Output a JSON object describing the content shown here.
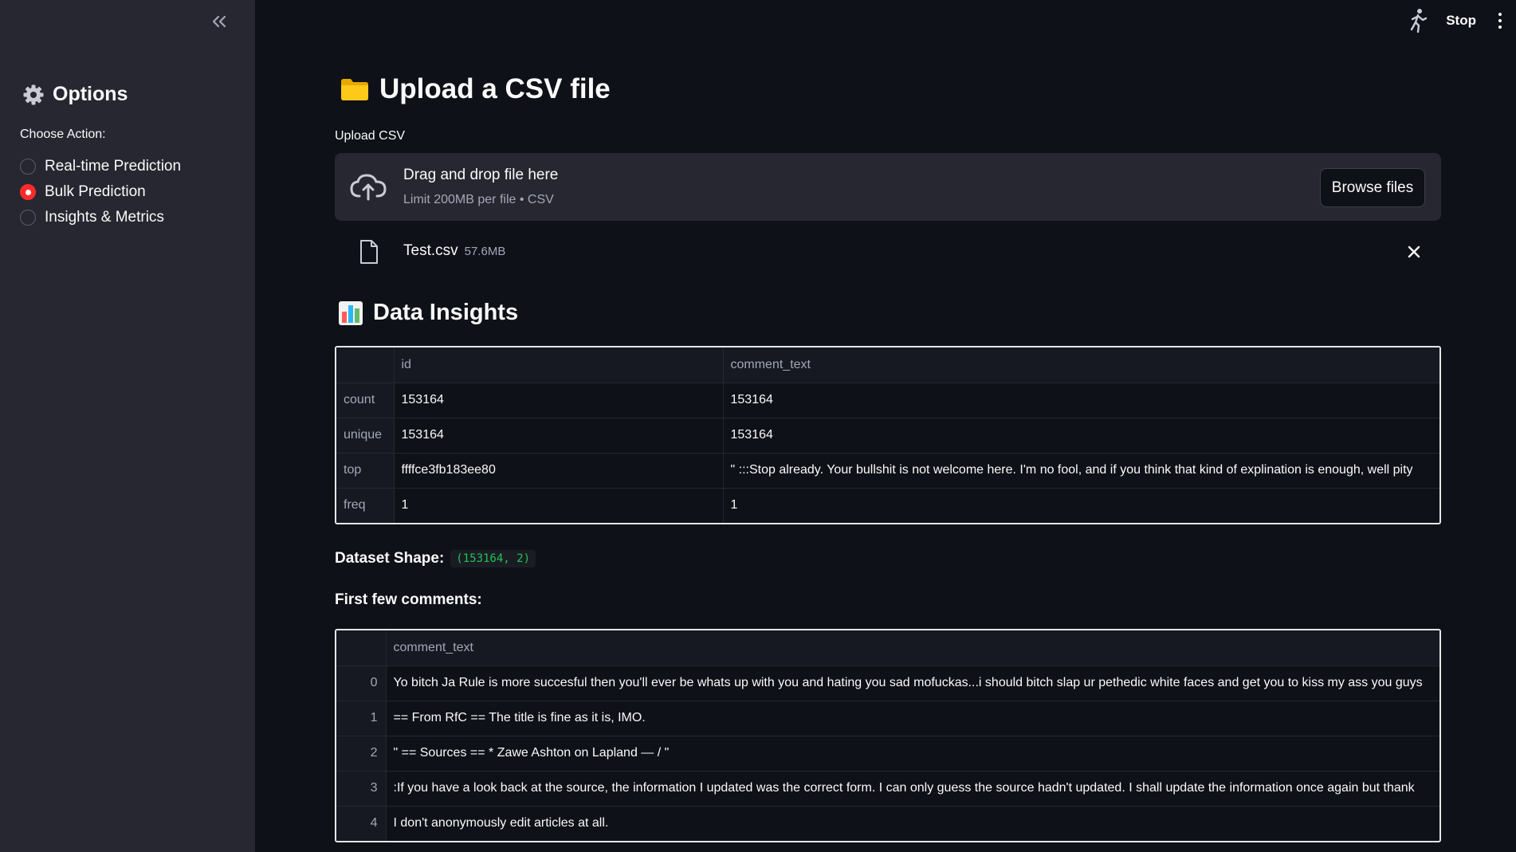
{
  "sidebar": {
    "header": "Options",
    "choose_label": "Choose Action:",
    "options": [
      {
        "label": "Real-time Prediction",
        "selected": false
      },
      {
        "label": "Bulk Prediction",
        "selected": true
      },
      {
        "label": "Insights & Metrics",
        "selected": false
      }
    ]
  },
  "topbar": {
    "stop_label": "Stop"
  },
  "main": {
    "title": "Upload a CSV file",
    "upload_label": "Upload CSV",
    "dropzone": {
      "title": "Drag and drop file here",
      "subtitle": "Limit 200MB per file • CSV",
      "browse_label": "Browse files"
    },
    "file": {
      "name": "Test.csv",
      "size": "57.6MB"
    },
    "insights_title": "Data Insights",
    "describe_table": {
      "columns": [
        "",
        "id",
        "comment_text"
      ],
      "rows": [
        {
          "index": "count",
          "id": "153164",
          "comment_text": "153164"
        },
        {
          "index": "unique",
          "id": "153164",
          "comment_text": "153164"
        },
        {
          "index": "top",
          "id": "ffffce3fb183ee80",
          "comment_text": "\"  :::Stop already. Your bullshit is not welcome here. I'm no fool, and if you think that kind of explination is enough, well pity"
        },
        {
          "index": "freq",
          "id": "1",
          "comment_text": "1"
        }
      ]
    },
    "shape_label": "Dataset Shape:",
    "shape_value": "(153164, 2)",
    "first_comments_label": "First few comments:",
    "comments_table": {
      "columns": [
        "",
        "comment_text"
      ],
      "rows": [
        {
          "index": "0",
          "comment_text": "Yo bitch Ja Rule is more succesful then you'll ever be whats up with you and hating you sad mofuckas...i should bitch slap ur pethedic white faces and get you to kiss my ass you guys"
        },
        {
          "index": "1",
          "comment_text": "== From RfC ==   The title is fine as it is, IMO."
        },
        {
          "index": "2",
          "comment_text": "\"   == Sources ==   * Zawe Ashton on Lapland —  /  \""
        },
        {
          "index": "3",
          "comment_text": ":If you have a look back at the source, the information I updated was the correct form. I can only guess the source hadn't updated. I shall update the information once again but thank"
        },
        {
          "index": "4",
          "comment_text": "I don't anonymously edit articles at all."
        }
      ]
    }
  },
  "icons": {
    "collapse": "double-chevron-left-icon",
    "gear": "gear-icon",
    "running": "running-man-icon",
    "menu": "kebab-menu-icon",
    "folder": "folder-icon",
    "cloud": "cloud-upload-icon",
    "file": "file-icon",
    "close": "close-icon",
    "chart": "bar-chart-icon"
  },
  "colors": {
    "background": "#0e1117",
    "sidebar": "#262730",
    "accent": "#ff2b2b",
    "code": "#21c354"
  }
}
